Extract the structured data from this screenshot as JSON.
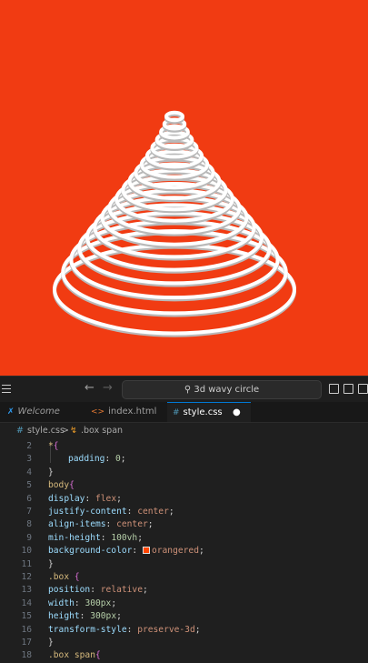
{
  "preview": {
    "background_color": "#f13b12",
    "ring_color": "#ffffff",
    "ring_count": 19
  },
  "titlebar": {
    "back_icon": "arrow-left-icon",
    "forward_icon": "arrow-right-icon",
    "search_icon": "search-icon",
    "search_text": "3d wavy circle"
  },
  "tabs": [
    {
      "label": "Welcome",
      "icon": "vscode-logo-icon",
      "active": false
    },
    {
      "label": "index.html",
      "icon": "html-file-icon",
      "active": false
    },
    {
      "label": "style.css",
      "icon": "css-file-icon",
      "active": true,
      "modified": true
    }
  ],
  "breadcrumb": {
    "file": "style.css",
    "separator": ">",
    "selector": ".box span"
  },
  "editor": {
    "lines": [
      {
        "n": "2",
        "t": "*{"
      },
      {
        "n": "3",
        "t": "padding: 0;"
      },
      {
        "n": "4",
        "t": "}"
      },
      {
        "n": "5",
        "t": "body{"
      },
      {
        "n": "6",
        "t": "display: flex;"
      },
      {
        "n": "7",
        "t": "justify-content: center;"
      },
      {
        "n": "8",
        "t": "align-items: center;"
      },
      {
        "n": "9",
        "t": "min-height: 100vh;"
      },
      {
        "n": "10",
        "t": "background-color: orangered;"
      },
      {
        "n": "11",
        "t": "}"
      },
      {
        "n": "12",
        "t": ".box {"
      },
      {
        "n": "13",
        "t": "position: relative;"
      },
      {
        "n": "14",
        "t": "width: 300px;"
      },
      {
        "n": "15",
        "t": "height: 300px;"
      },
      {
        "n": "16",
        "t": "transform-style: preserve-3d;"
      },
      {
        "n": "17",
        "t": "}"
      },
      {
        "n": "18",
        "t": ".box span{"
      }
    ],
    "swatch_color": "#ff4500"
  }
}
